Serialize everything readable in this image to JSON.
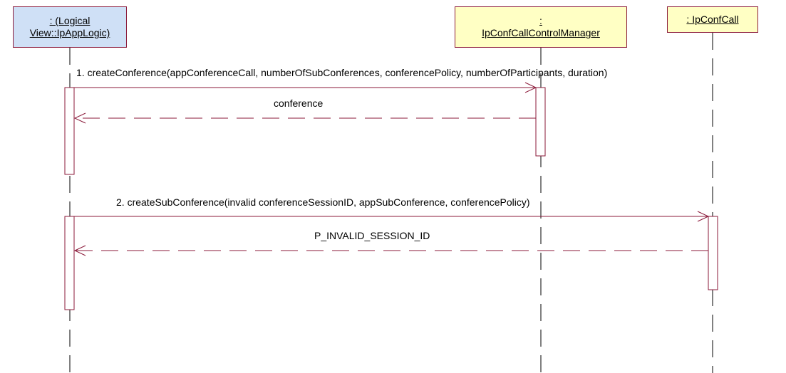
{
  "participants": [
    {
      "label_line1": ": (Logical",
      "label_line2": "View::IpAppLogic)"
    },
    {
      "label_line1": ":",
      "label_line2": "IpConfCallControlManager"
    },
    {
      "label_line1": ": IpConfCall",
      "label_line2": ""
    }
  ],
  "messages": [
    {
      "label": "1. createConference(appConferenceCall, numberOfSubConferences, conferencePolicy, numberOfParticipants, duration)",
      "from": "IpAppLogic",
      "to": "IpConfCallControlManager",
      "kind": "call"
    },
    {
      "label": "conference",
      "from": "IpConfCallControlManager",
      "to": "IpAppLogic",
      "kind": "return"
    },
    {
      "label": "2. createSubConference(invalid conferenceSessionID, appSubConference, conferencePolicy)",
      "from": "IpAppLogic",
      "to": "IpConfCall",
      "kind": "call"
    },
    {
      "label": "P_INVALID_SESSION_ID",
      "from": "IpConfCall",
      "to": "IpAppLogic",
      "kind": "return"
    }
  ],
  "colors": {
    "line": "#8b1a3a",
    "lifeline": "#000000",
    "box_blue": "#cfe0f6",
    "box_yellow": "#ffffc4"
  }
}
